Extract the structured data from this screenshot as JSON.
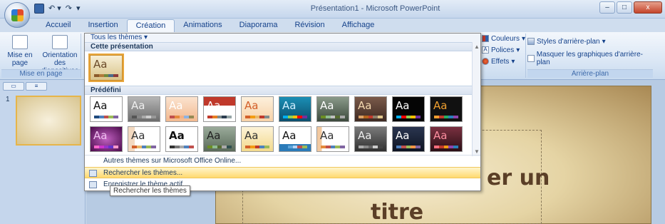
{
  "window": {
    "title": "Présentation1 - Microsoft PowerPoint",
    "controls": [
      "–",
      "□",
      "x"
    ]
  },
  "tabs": [
    {
      "label": "Accueil"
    },
    {
      "label": "Insertion"
    },
    {
      "label": "Création"
    },
    {
      "label": "Animations"
    },
    {
      "label": "Diaporama"
    },
    {
      "label": "Révision"
    },
    {
      "label": "Affichage"
    }
  ],
  "active_tab": "Création",
  "ribbon": {
    "mise_en_page": {
      "btn1": "Mise en page",
      "btn2": "Orientation des diapositives",
      "group_label": "Mise en page"
    },
    "theme_options": {
      "couleurs": "Couleurs",
      "polices": "Polices",
      "effets": "Effets"
    },
    "arriere_plan": {
      "styles": "Styles d'arrière-plan",
      "masquer": "Masquer les graphiques d'arrière-plan",
      "group_label": "Arrière-plan"
    }
  },
  "gallery": {
    "header": "Tous les thèmes ▾",
    "section_current": "Cette présentation",
    "section_predefined": "Prédéfini",
    "theme_label": "Aa",
    "cmd_online": "Autres thèmes sur Microsoft Office Online...",
    "cmd_browse": "Rechercher les thèmes...",
    "cmd_save": "Enregistrer le thème actif..."
  },
  "tooltip": "Rechercher les thèmes",
  "slide": {
    "num": "1",
    "title_part1": "er un",
    "title_part2": "titre"
  },
  "icons": [
    "office-button-icon",
    "save-icon",
    "undo-icon",
    "redo-icon",
    "scroll-up-icon",
    "scroll-down-icon",
    "folder-icon",
    "save-theme-icon"
  ]
}
